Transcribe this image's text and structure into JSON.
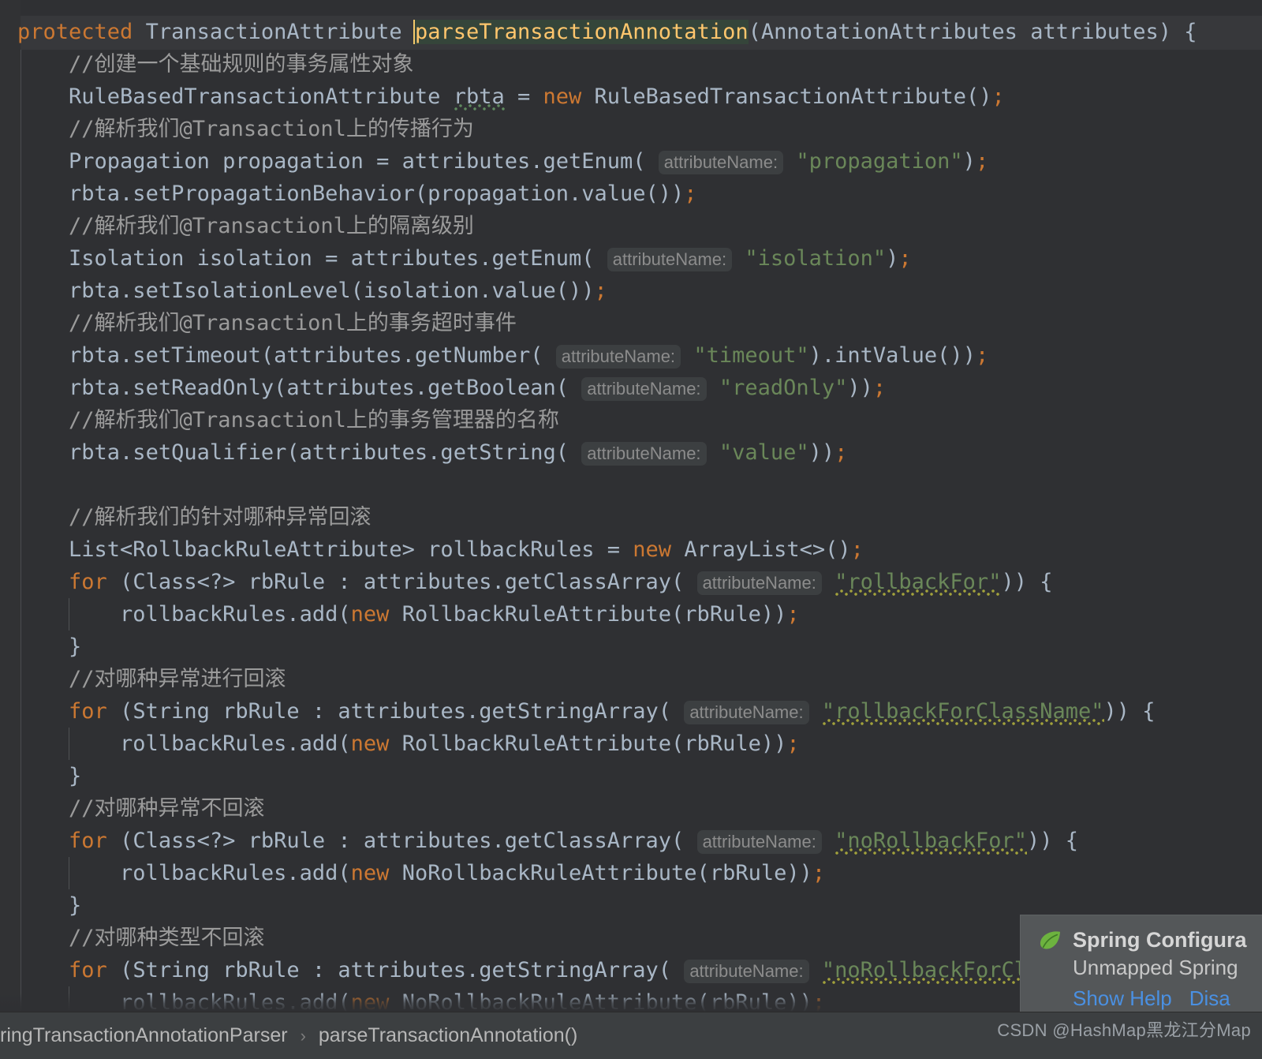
{
  "editor": {
    "caret_line_index": 0,
    "selected_symbol": "parseTransactionAnnotation",
    "lines": [
      {
        "id": "l1",
        "indent": 0,
        "parts": [
          {
            "t": "protected ",
            "c": "kw"
          },
          {
            "t": "TransactionAttribute ",
            "c": "txt"
          },
          {
            "t": "parseTransactionAnnotation",
            "c": "sel-fn"
          },
          {
            "t": "(AnnotationAttributes attributes) {",
            "c": "txt"
          }
        ]
      },
      {
        "id": "l2",
        "indent": 1,
        "parts": [
          {
            "t": "//创建一个基础规则的事务属性对象",
            "c": "cmt"
          }
        ]
      },
      {
        "id": "l3",
        "indent": 1,
        "parts": [
          {
            "t": "RuleBasedTransactionAttribute ",
            "c": "txt"
          },
          {
            "t": "rbta",
            "c": "squig-tid"
          },
          {
            "t": " = ",
            "c": "txt"
          },
          {
            "t": "new ",
            "c": "kw"
          },
          {
            "t": "RuleBasedTransactionAttribute()",
            "c": "txt"
          },
          {
            "t": ";",
            "c": "semi"
          }
        ]
      },
      {
        "id": "l4",
        "indent": 1,
        "parts": [
          {
            "t": "//解析我们@Transactionl上的传播行为",
            "c": "cmt"
          }
        ]
      },
      {
        "id": "l5",
        "indent": 1,
        "parts": [
          {
            "t": "Propagation propagation = attributes.getEnum( ",
            "c": "txt"
          },
          {
            "t": "attributeName:",
            "c": "hint"
          },
          {
            "t": " ",
            "c": "txt"
          },
          {
            "t": "\"propagation\"",
            "c": "str"
          },
          {
            "t": ")",
            "c": "txt"
          },
          {
            "t": ";",
            "c": "semi"
          }
        ]
      },
      {
        "id": "l6",
        "indent": 1,
        "parts": [
          {
            "t": "rbta.setPropagationBehavior(propagation.value())",
            "c": "txt"
          },
          {
            "t": ";",
            "c": "semi"
          }
        ]
      },
      {
        "id": "l7",
        "indent": 1,
        "parts": [
          {
            "t": "//解析我们@Transactionl上的隔离级别",
            "c": "cmt"
          }
        ]
      },
      {
        "id": "l8",
        "indent": 1,
        "parts": [
          {
            "t": "Isolation isolation = attributes.getEnum( ",
            "c": "txt"
          },
          {
            "t": "attributeName:",
            "c": "hint"
          },
          {
            "t": " ",
            "c": "txt"
          },
          {
            "t": "\"isolation\"",
            "c": "str"
          },
          {
            "t": ")",
            "c": "txt"
          },
          {
            "t": ";",
            "c": "semi"
          }
        ]
      },
      {
        "id": "l9",
        "indent": 1,
        "parts": [
          {
            "t": "rbta.setIsolationLevel(isolation.value())",
            "c": "txt"
          },
          {
            "t": ";",
            "c": "semi"
          }
        ]
      },
      {
        "id": "l10",
        "indent": 1,
        "parts": [
          {
            "t": "//解析我们@Transactionl上的事务超时事件",
            "c": "cmt"
          }
        ]
      },
      {
        "id": "l11",
        "indent": 1,
        "parts": [
          {
            "t": "rbta.setTimeout(attributes.getNumber( ",
            "c": "txt"
          },
          {
            "t": "attributeName:",
            "c": "hint"
          },
          {
            "t": " ",
            "c": "txt"
          },
          {
            "t": "\"timeout\"",
            "c": "str"
          },
          {
            "t": ").intValue())",
            "c": "txt"
          },
          {
            "t": ";",
            "c": "semi"
          }
        ]
      },
      {
        "id": "l12",
        "indent": 1,
        "parts": [
          {
            "t": "rbta.setReadOnly(attributes.getBoolean( ",
            "c": "txt"
          },
          {
            "t": "attributeName:",
            "c": "hint"
          },
          {
            "t": " ",
            "c": "txt"
          },
          {
            "t": "\"readOnly\"",
            "c": "str"
          },
          {
            "t": "))",
            "c": "txt"
          },
          {
            "t": ";",
            "c": "semi"
          }
        ]
      },
      {
        "id": "l13",
        "indent": 1,
        "parts": [
          {
            "t": "//解析我们@Transactionl上的事务管理器的名称",
            "c": "cmt"
          }
        ]
      },
      {
        "id": "l14",
        "indent": 1,
        "parts": [
          {
            "t": "rbta.setQualifier(attributes.getString( ",
            "c": "txt"
          },
          {
            "t": "attributeName:",
            "c": "hint"
          },
          {
            "t": " ",
            "c": "txt"
          },
          {
            "t": "\"value\"",
            "c": "str"
          },
          {
            "t": "))",
            "c": "txt"
          },
          {
            "t": ";",
            "c": "semi"
          }
        ]
      },
      {
        "id": "l15",
        "indent": 0,
        "parts": [
          {
            "t": "",
            "c": "txt"
          }
        ]
      },
      {
        "id": "l16",
        "indent": 1,
        "parts": [
          {
            "t": "//解析我们的针对哪种异常回滚",
            "c": "cmt"
          }
        ]
      },
      {
        "id": "l17",
        "indent": 1,
        "parts": [
          {
            "t": "List<RollbackRuleAttribute> rollbackRules = ",
            "c": "txt"
          },
          {
            "t": "new ",
            "c": "kw"
          },
          {
            "t": "ArrayList<>()",
            "c": "txt"
          },
          {
            "t": ";",
            "c": "semi"
          }
        ]
      },
      {
        "id": "l18",
        "indent": 1,
        "parts": [
          {
            "t": "for ",
            "c": "kw"
          },
          {
            "t": "(Class<?> rbRule : attributes.getClassArray( ",
            "c": "txt"
          },
          {
            "t": "attributeName:",
            "c": "hint"
          },
          {
            "t": " ",
            "c": "txt"
          },
          {
            "t": "\"rollbackFor\"",
            "c": "str squig"
          },
          {
            "t": ")) {",
            "c": "txt"
          }
        ]
      },
      {
        "id": "l19",
        "indent": 2,
        "guide": true,
        "parts": [
          {
            "t": "rollbackRules.add(",
            "c": "txt"
          },
          {
            "t": "new ",
            "c": "kw"
          },
          {
            "t": "RollbackRuleAttribute(rbRule))",
            "c": "txt"
          },
          {
            "t": ";",
            "c": "semi"
          }
        ]
      },
      {
        "id": "l20",
        "indent": 1,
        "parts": [
          {
            "t": "}",
            "c": "txt"
          }
        ]
      },
      {
        "id": "l21",
        "indent": 1,
        "parts": [
          {
            "t": "//对哪种异常进行回滚",
            "c": "cmt"
          }
        ]
      },
      {
        "id": "l22",
        "indent": 1,
        "parts": [
          {
            "t": "for ",
            "c": "kw"
          },
          {
            "t": "(String rbRule : attributes.getStringArray( ",
            "c": "txt"
          },
          {
            "t": "attributeName:",
            "c": "hint"
          },
          {
            "t": " ",
            "c": "txt"
          },
          {
            "t": "\"rollbackForClassName\"",
            "c": "str squig"
          },
          {
            "t": ")) {",
            "c": "txt"
          }
        ]
      },
      {
        "id": "l23",
        "indent": 2,
        "guide": true,
        "parts": [
          {
            "t": "rollbackRules.add(",
            "c": "txt"
          },
          {
            "t": "new ",
            "c": "kw"
          },
          {
            "t": "RollbackRuleAttribute(rbRule))",
            "c": "txt"
          },
          {
            "t": ";",
            "c": "semi"
          }
        ]
      },
      {
        "id": "l24",
        "indent": 1,
        "parts": [
          {
            "t": "}",
            "c": "txt"
          }
        ]
      },
      {
        "id": "l25",
        "indent": 1,
        "parts": [
          {
            "t": "//对哪种异常不回滚",
            "c": "cmt"
          }
        ]
      },
      {
        "id": "l26",
        "indent": 1,
        "parts": [
          {
            "t": "for ",
            "c": "kw"
          },
          {
            "t": "(Class<?> rbRule : attributes.getClassArray( ",
            "c": "txt"
          },
          {
            "t": "attributeName:",
            "c": "hint"
          },
          {
            "t": " ",
            "c": "txt"
          },
          {
            "t": "\"noRollbackFor\"",
            "c": "str squig"
          },
          {
            "t": ")) {",
            "c": "txt"
          }
        ]
      },
      {
        "id": "l27",
        "indent": 2,
        "guide": true,
        "parts": [
          {
            "t": "rollbackRules.add(",
            "c": "txt"
          },
          {
            "t": "new ",
            "c": "kw"
          },
          {
            "t": "NoRollbackRuleAttribute(rbRule))",
            "c": "txt"
          },
          {
            "t": ";",
            "c": "semi"
          }
        ]
      },
      {
        "id": "l28",
        "indent": 1,
        "parts": [
          {
            "t": "}",
            "c": "txt"
          }
        ]
      },
      {
        "id": "l29",
        "indent": 1,
        "parts": [
          {
            "t": "//对哪种类型不回滚",
            "c": "cmt"
          }
        ]
      },
      {
        "id": "l30",
        "indent": 1,
        "parts": [
          {
            "t": "for ",
            "c": "kw"
          },
          {
            "t": "(String rbRule : attributes.getStringArray( ",
            "c": "txt"
          },
          {
            "t": "attributeName:",
            "c": "hint"
          },
          {
            "t": " ",
            "c": "txt"
          },
          {
            "t": "\"noRollbackForCla",
            "c": "str squig"
          }
        ]
      },
      {
        "id": "l31",
        "indent": 2,
        "guide": true,
        "parts": [
          {
            "t": "rollbackRules.add(",
            "c": "txt"
          },
          {
            "t": "new ",
            "c": "kw"
          },
          {
            "t": "NoRollbackRuleAttribute(rbRule))",
            "c": "txt"
          },
          {
            "t": ";",
            "c": "semi"
          }
        ]
      }
    ]
  },
  "breadcrumb": {
    "items": [
      {
        "label": "ringTransactionAnnotationParser"
      },
      {
        "label": "parseTransactionAnnotation()"
      }
    ],
    "separator": "›"
  },
  "notification": {
    "icon": "spring-leaf-icon",
    "title": "Spring Configura",
    "subtitle": "Unmapped Spring",
    "links": [
      {
        "label": "Show Help"
      },
      {
        "label": "Disa"
      }
    ]
  },
  "watermark": {
    "text": "CSDN @HashMap黑龙江分Map"
  },
  "colors": {
    "editor_bg": "#2f3033",
    "gutter_bg": "#313234",
    "caret_line_bg": "#37383b",
    "keyword": "#cc7832",
    "text": "#a9b7c6",
    "comment": "#9b9b9b",
    "string": "#6a8759",
    "function_name": "#ffc66d",
    "hint_bg": "#3c3f41",
    "hint_fg": "#8c8c8c",
    "selection_bg": "#35453a",
    "squiggle": "#a2a23c",
    "status_bar_bg": "#3c3f41",
    "popup_bg": "#545759",
    "popup_link": "#4a90e2",
    "spring_green": "#6db33f"
  }
}
